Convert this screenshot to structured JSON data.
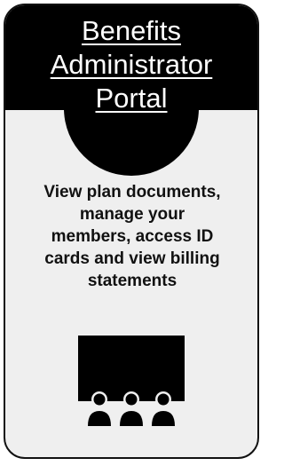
{
  "card": {
    "title_lines": [
      "Benefits",
      "Administrator",
      "Portal"
    ],
    "description": "View plan documents,\nmanage your\nmembers, access ID\ncards and view billing\nstatements",
    "icon": "presentation-audience-icon"
  },
  "colors": {
    "header_bg": "#000000",
    "card_bg": "#efefef",
    "title_text": "#ffffff",
    "body_text": "#111111",
    "border": "#111111"
  }
}
